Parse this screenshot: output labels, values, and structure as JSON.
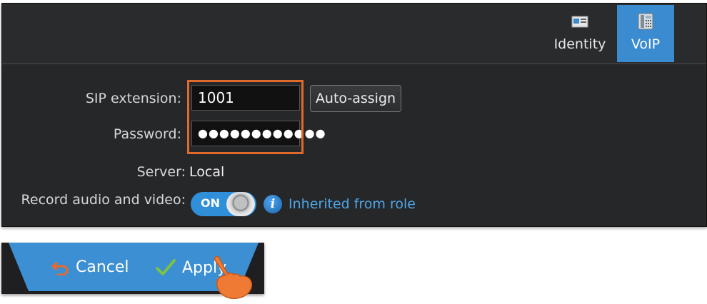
{
  "tabs": [
    {
      "label": "Identity",
      "icon": "id-card-icon",
      "active": false
    },
    {
      "label": "VoIP",
      "icon": "desk-phone-icon",
      "active": true
    }
  ],
  "form": {
    "sip_label": "SIP extension:",
    "sip_value": "1001",
    "password_label": "Password:",
    "password_value": "●●●●●●●●●●●●",
    "auto_assign": "Auto-assign",
    "server_label": "Server:",
    "server_value": "Local",
    "record_label": "Record audio and video:",
    "toggle_state": "ON",
    "inherited": "Inherited from role"
  },
  "actions": {
    "cancel": "Cancel",
    "apply": "Apply"
  },
  "colors": {
    "accent": "#3b8bd0",
    "highlight": "#e06a2c",
    "link": "#4fa6e8",
    "panel": "#262729"
  }
}
